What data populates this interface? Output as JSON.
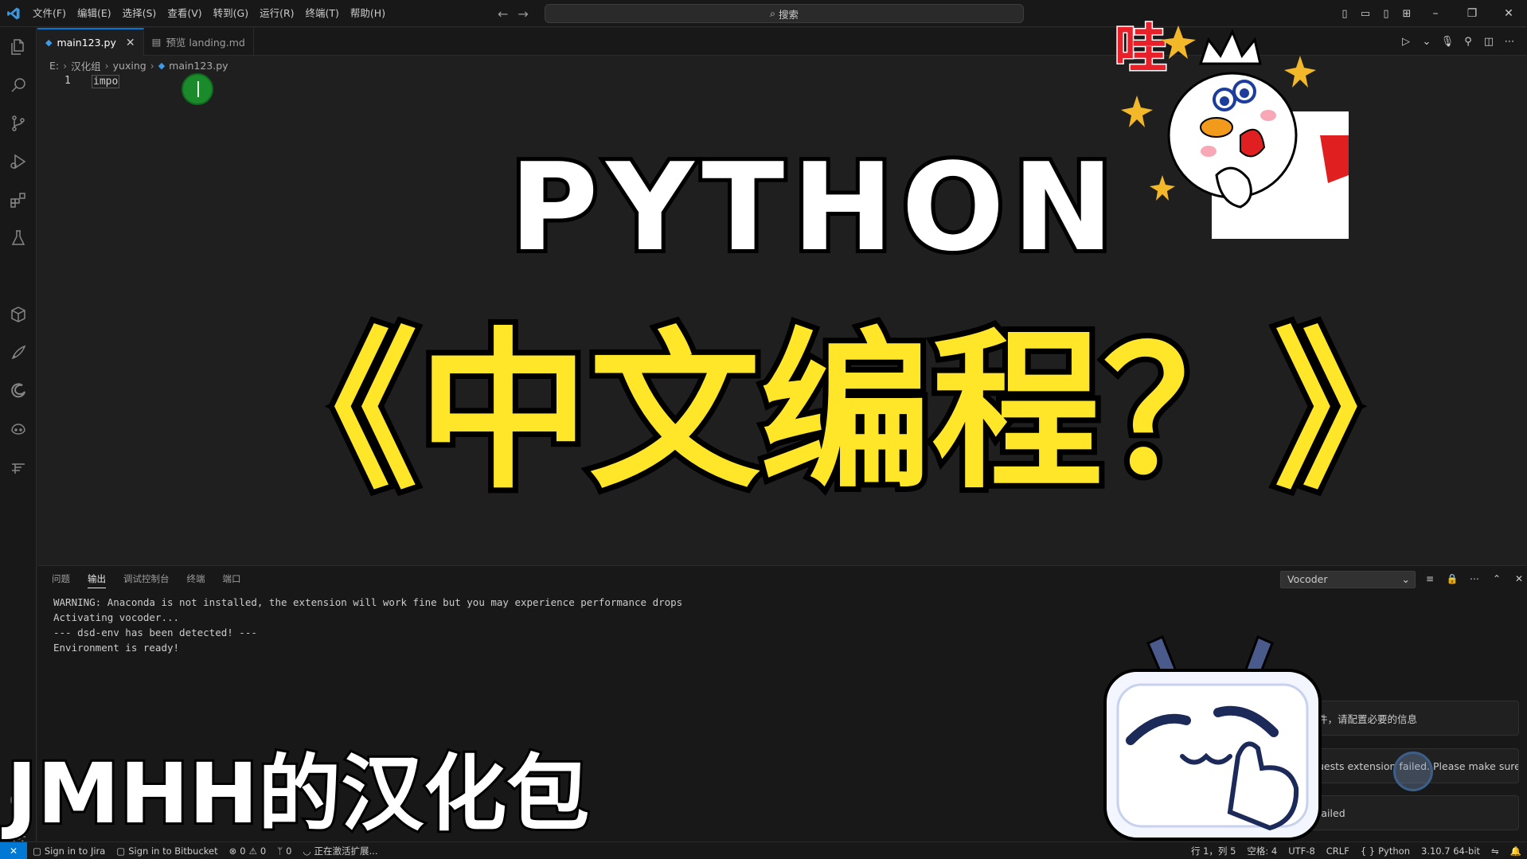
{
  "menu": [
    "文件(F)",
    "编辑(E)",
    "选择(S)",
    "查看(V)",
    "转到(G)",
    "运行(R)",
    "终端(T)",
    "帮助(H)"
  ],
  "search": {
    "label": "搜索"
  },
  "tabs": [
    {
      "label": "main123.py",
      "icon": "python-file-icon",
      "active": true
    },
    {
      "label": "预览 landing.md",
      "icon": "preview-icon",
      "active": false
    }
  ],
  "breadcrumb": [
    "E:",
    "汉化组",
    "yuxing",
    "main123.py"
  ],
  "editor": {
    "line_number": "1",
    "code": "impo"
  },
  "overlay": {
    "python": "PYTHON",
    "chinese": "《中文编程？》",
    "caption": "JMHH的汉化包",
    "wa": "哇"
  },
  "panel": {
    "tabs": [
      "问题",
      "输出",
      "调试控制台",
      "终端",
      "端口"
    ],
    "active_tab": "输出",
    "select": "Vocoder",
    "output": [
      "WARNING: Anaconda is not installed, the extension will work fine but you may experience performance drops",
      "Activating vocoder...",
      "--- dsd-env has been detected! ---",
      "Environment is ready!"
    ]
  },
  "notifications": [
    "件，请配置必要的信息",
    "uests extension failed. Please make sure y...",
    "failed"
  ],
  "statusbar": {
    "jira": "Sign in to Jira",
    "bitbucket": "Sign in to Bitbucket",
    "errors": "0",
    "warnings": "0",
    "ports": "0",
    "activating": "正在激活扩展...",
    "position": "行 1，列 5",
    "spaces": "空格: 4",
    "encoding": "UTF-8",
    "eol": "CRLF",
    "language": "Python",
    "interpreter": "3.10.7 64-bit"
  },
  "colors": {
    "accent": "#0078d4",
    "chinese_title": "#ffe629",
    "wa": "#e8202a"
  }
}
